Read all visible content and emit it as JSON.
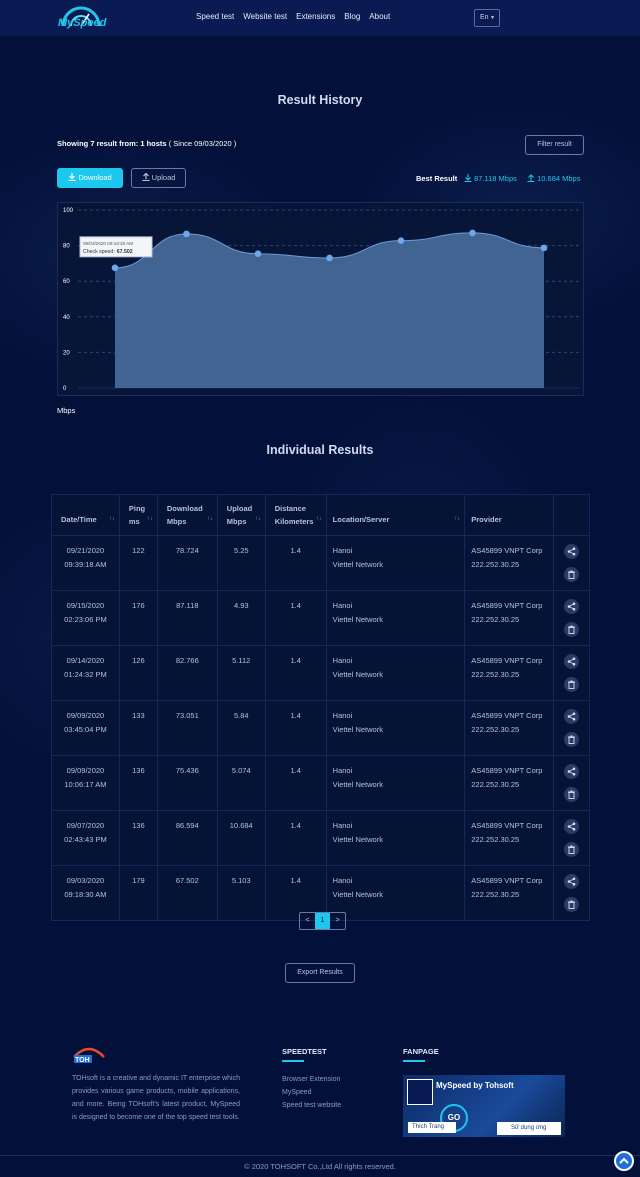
{
  "header": {
    "logo_text": "MySpeed",
    "nav": [
      "Speed test",
      "Website test",
      "Extensions",
      "Blog",
      "About"
    ],
    "lang": "En"
  },
  "history": {
    "title": "Result History",
    "showing_label": "Showing 7 result from: 1 hosts",
    "showing_since": "( Since 09/03/2020 )",
    "filter_label": "Filter result",
    "download_label": "Download",
    "upload_label": "Upload",
    "best_label": "Best Result",
    "best_download": "87.118 Mbps",
    "best_upload": "10.684 Mbps",
    "unit_label": "Mbps",
    "tooltip_date": "09/03/2020 09:18:30 AM",
    "tooltip_label": "Check speed:",
    "tooltip_value": "67.502"
  },
  "chart_data": {
    "type": "area",
    "x": [
      "09/03/2020 09:18:30 AM",
      "09/07/2020 02:43:43 PM",
      "09/09/2020 10:06:17 AM",
      "09/09/2020 03:45:04 PM",
      "09/14/2020 01:24:32 PM",
      "09/15/2020 02:23:06 PM",
      "09/21/2020 09:39:18 AM"
    ],
    "values": [
      67.502,
      86.594,
      75.436,
      73.051,
      82.766,
      87.118,
      78.724
    ],
    "yticks": [
      0,
      20,
      40,
      60,
      80,
      100
    ],
    "ylim": [
      0,
      100
    ],
    "ylabel": "Mbps",
    "grid": true,
    "colors": {
      "fill": "#426493",
      "line": "#6f9ad6",
      "point": "#6ea8ec"
    }
  },
  "table": {
    "title": "Individual Results",
    "headers": [
      {
        "l1": "Date/Time",
        "l2": ""
      },
      {
        "l1": "Ping",
        "l2": "ms"
      },
      {
        "l1": "Download",
        "l2": "Mbps"
      },
      {
        "l1": "Upload",
        "l2": "Mbps"
      },
      {
        "l1": "Distance",
        "l2": "Kilometers"
      },
      {
        "l1": "Location/Server",
        "l2": ""
      },
      {
        "l1": "Provider",
        "l2": ""
      }
    ],
    "rows": [
      {
        "date": "09/21/2020",
        "time": "09:39:18 AM",
        "ping": "122",
        "download": "78.724",
        "upload": "5.25",
        "distance": "1.4",
        "city": "Hanoi",
        "server": "Viettel Network",
        "provider": "AS45899 VNPT Corp",
        "ip": "222.252.30.25"
      },
      {
        "date": "09/15/2020",
        "time": "02:23:06 PM",
        "ping": "176",
        "download": "87.118",
        "upload": "4.93",
        "distance": "1.4",
        "city": "Hanoi",
        "server": "Viettel Network",
        "provider": "AS45899 VNPT Corp",
        "ip": "222.252.30.25"
      },
      {
        "date": "09/14/2020",
        "time": "01:24:32 PM",
        "ping": "126",
        "download": "82.766",
        "upload": "5.112",
        "distance": "1.4",
        "city": "Hanoi",
        "server": "Viettel Network",
        "provider": "AS45899 VNPT Corp",
        "ip": "222.252.30.25"
      },
      {
        "date": "09/09/2020",
        "time": "03:45:04 PM",
        "ping": "133",
        "download": "73.051",
        "upload": "5.84",
        "distance": "1.4",
        "city": "Hanoi",
        "server": "Viettel Network",
        "provider": "AS45899 VNPT Corp",
        "ip": "222.252.30.25"
      },
      {
        "date": "09/09/2020",
        "time": "10:06:17 AM",
        "ping": "136",
        "download": "75.436",
        "upload": "5.074",
        "distance": "1.4",
        "city": "Hanoi",
        "server": "Viettel Network",
        "provider": "AS45899 VNPT Corp",
        "ip": "222.252.30.25"
      },
      {
        "date": "09/07/2020",
        "time": "02:43:43 PM",
        "ping": "136",
        "download": "86.594",
        "upload": "10.684",
        "distance": "1.4",
        "city": "Hanoi",
        "server": "Viettel Network",
        "provider": "AS45899 VNPT Corp",
        "ip": "222.252.30.25"
      },
      {
        "date": "09/03/2020",
        "time": "09:18:30 AM",
        "ping": "179",
        "download": "67.502",
        "upload": "5.103",
        "distance": "1.4",
        "city": "Hanoi",
        "server": "Viettel Network",
        "provider": "AS45899 VNPT Corp",
        "ip": "222.252.30.25"
      }
    ],
    "pager": {
      "prev": "<",
      "current": "1",
      "next": ">"
    },
    "export_label": "Export Results"
  },
  "footer": {
    "about": "TOHsoft is a creative and dynamic IT enterprise which provides various game products, mobile applications, and more. Being TOHsoft's latest product, MySpeed is designed to become one of the top speed test tools.",
    "speedtest_heading": "SPEEDTEST",
    "links": [
      "Browser Extension",
      "MySpeed",
      "Speed test website"
    ],
    "fanpage_heading": "FANPAGE",
    "fanpage_title": "MySpeed by Tohsoft",
    "fanpage_go": "GO",
    "fanpage_like": "Thích Trang",
    "fanpage_use": "Sử dụng ứng dụng",
    "copyright": "© 2020 TOHSOFT Co.,Ltd All rights reserved."
  },
  "colors": {
    "accent": "#1cc8ee",
    "background": "#03113a",
    "header": "#0a1a52"
  }
}
